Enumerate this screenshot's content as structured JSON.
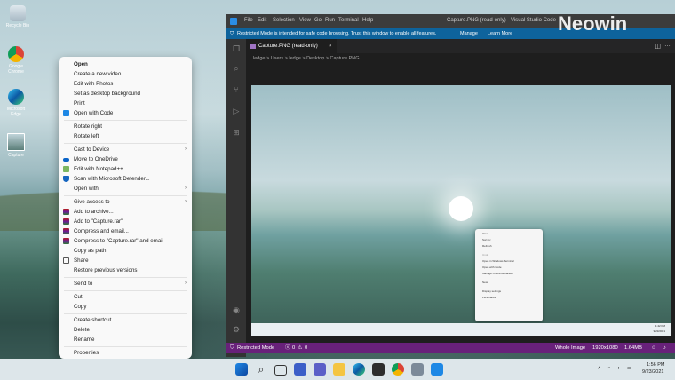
{
  "desktop": {
    "icons": [
      {
        "label": "Recycle Bin"
      },
      {
        "label": "Google Chrome"
      },
      {
        "label": "Microsoft Edge"
      },
      {
        "label": "Capture"
      }
    ]
  },
  "context_menu": {
    "items": [
      {
        "label": "Open",
        "bold": true
      },
      {
        "label": "Create a new video"
      },
      {
        "label": "Edit with Photos"
      },
      {
        "label": "Set as desktop background"
      },
      {
        "label": "Print"
      },
      {
        "label": "Open with Code"
      },
      {
        "label": "Rotate right"
      },
      {
        "label": "Rotate left"
      },
      {
        "label": "Cast to Device",
        "submenu": true
      },
      {
        "label": "Move to OneDrive"
      },
      {
        "label": "Edit with Notepad++"
      },
      {
        "label": "Scan with Microsoft Defender..."
      },
      {
        "label": "Open with",
        "submenu": true
      },
      {
        "label": "Give access to",
        "submenu": true
      },
      {
        "label": "Add to archive..."
      },
      {
        "label": "Add to \"Capture.rar\""
      },
      {
        "label": "Compress and email..."
      },
      {
        "label": "Compress to \"Capture.rar\" and email"
      },
      {
        "label": "Copy as path"
      },
      {
        "label": "Share"
      },
      {
        "label": "Restore previous versions"
      },
      {
        "label": "Send to",
        "submenu": true
      },
      {
        "label": "Cut"
      },
      {
        "label": "Copy"
      },
      {
        "label": "Create shortcut"
      },
      {
        "label": "Delete"
      },
      {
        "label": "Rename"
      },
      {
        "label": "Properties"
      }
    ],
    "submenu_arrow": "›"
  },
  "vscode": {
    "menu": [
      "File",
      "Edit",
      "Selection",
      "View",
      "Go",
      "Run",
      "Terminal",
      "Help"
    ],
    "title": "Capture.PNG (read-only) - Visual Studio Code",
    "banner": {
      "text": "Restricted Mode is intended for safe code browsing. Trust this window to enable all features.",
      "manage": "Manage",
      "learn_more": "Learn More"
    },
    "tab": {
      "label": "Capture.PNG (read-only)",
      "close": "×"
    },
    "breadcrumb": "ledge > Users > ledge > Desktop > Capture.PNG",
    "status": {
      "restricted": "Restricted Mode",
      "errors": "0",
      "warnings": "0",
      "whole_image": "Whole Image",
      "dimensions": "1920x1080",
      "size": "1.64MB"
    },
    "mini_menu": [
      "View",
      "Sort by",
      "Refresh",
      "Undo",
      "Open in Windows Terminal",
      "Open with Code",
      "Manage OneDrive backup",
      "New",
      "Display settings",
      "Personalize"
    ],
    "mini_clock": {
      "time": "1:42 PM",
      "date": "9/23/2021"
    }
  },
  "watermark": "Neowin",
  "taskbar": {
    "time": "1:56 PM",
    "date": "9/23/2021"
  },
  "colors": {
    "vscode_status": "#68217a",
    "vscode_banner": "#0e639c",
    "menu_bg": "#f9f9f9"
  }
}
